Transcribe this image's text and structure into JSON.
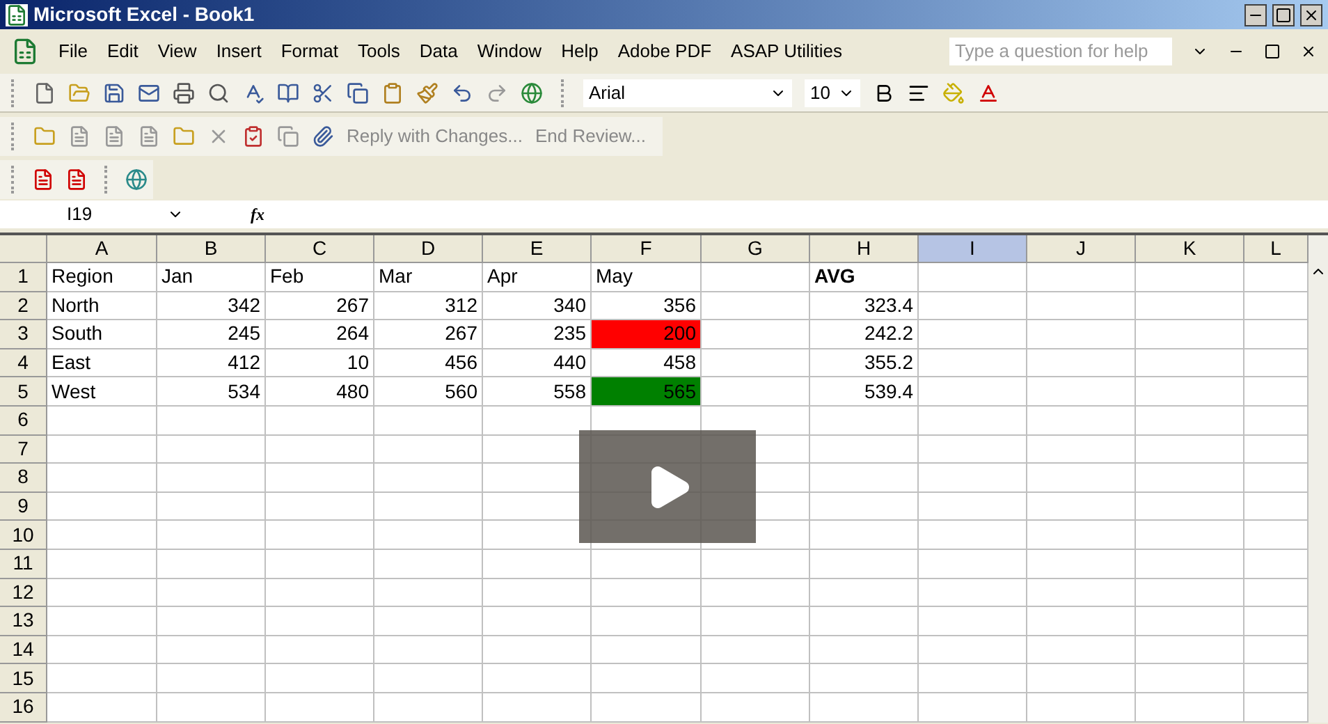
{
  "window": {
    "title": "Microsoft Excel - Book1"
  },
  "menu": [
    "File",
    "Edit",
    "View",
    "Insert",
    "Format",
    "Tools",
    "Data",
    "Window",
    "Help",
    "Adobe PDF",
    "ASAP Utilities"
  ],
  "help_search": {
    "placeholder": "Type a question for help"
  },
  "formatting": {
    "font": "Arial",
    "size": "10"
  },
  "review_toolbar": [
    "Reply with Changes...",
    "End Review..."
  ],
  "name_box": "I19",
  "formula_bar": {
    "label": "fx"
  },
  "columns": [
    {
      "label": "A",
      "selected": false
    },
    {
      "label": "B",
      "selected": false
    },
    {
      "label": "C",
      "selected": false
    },
    {
      "label": "D",
      "selected": false
    },
    {
      "label": "E",
      "selected": false
    },
    {
      "label": "F",
      "selected": false
    },
    {
      "label": "G",
      "selected": false
    },
    {
      "label": "H",
      "selected": false
    },
    {
      "label": "I",
      "selected": true
    },
    {
      "label": "J",
      "selected": false
    },
    {
      "label": "K",
      "selected": false
    },
    {
      "label": "L",
      "selected": false
    }
  ],
  "rows": [
    {
      "number": "1",
      "cells": [
        {
          "text": "Region",
          "kind": "text"
        },
        {
          "text": "Jan",
          "kind": "text"
        },
        {
          "text": "Feb",
          "kind": "text"
        },
        {
          "text": "Mar",
          "kind": "text"
        },
        {
          "text": "Apr",
          "kind": "text"
        },
        {
          "text": "May",
          "kind": "text"
        },
        null,
        {
          "text": "AVG",
          "kind": "heading"
        }
      ]
    },
    {
      "number": "2",
      "cells": [
        {
          "text": "North",
          "kind": "text"
        },
        {
          "text": "342",
          "kind": "number"
        },
        {
          "text": "267",
          "kind": "number"
        },
        {
          "text": "312",
          "kind": "number"
        },
        {
          "text": "340",
          "kind": "number"
        },
        {
          "text": "356",
          "kind": "number"
        },
        null,
        {
          "text": "323.4",
          "kind": "number"
        }
      ]
    },
    {
      "number": "3",
      "cells": [
        {
          "text": "South",
          "kind": "text"
        },
        {
          "text": "245",
          "kind": "number"
        },
        {
          "text": "264",
          "kind": "number"
        },
        {
          "text": "267",
          "kind": "number"
        },
        {
          "text": "235",
          "kind": "number"
        },
        {
          "text": "200",
          "kind": "number",
          "color": "#ff0000"
        },
        null,
        {
          "text": "242.2",
          "kind": "number"
        }
      ]
    },
    {
      "number": "4",
      "cells": [
        {
          "text": "East",
          "kind": "text"
        },
        {
          "text": "412",
          "kind": "number"
        },
        {
          "text": "10",
          "kind": "number"
        },
        {
          "text": "456",
          "kind": "number"
        },
        {
          "text": "440",
          "kind": "number"
        },
        {
          "text": "458",
          "kind": "number"
        },
        null,
        {
          "text": "355.2",
          "kind": "number"
        }
      ]
    },
    {
      "number": "5",
      "cells": [
        {
          "text": "West",
          "kind": "text"
        },
        {
          "text": "534",
          "kind": "number"
        },
        {
          "text": "480",
          "kind": "number"
        },
        {
          "text": "560",
          "kind": "number"
        },
        {
          "text": "558",
          "kind": "number"
        },
        {
          "text": "565",
          "kind": "number",
          "color": "#008000"
        },
        null,
        {
          "text": "539.4",
          "kind": "number"
        }
      ]
    },
    {
      "number": "6",
      "cells": []
    },
    {
      "number": "7",
      "cells": []
    },
    {
      "number": "8",
      "cells": []
    },
    {
      "number": "9",
      "cells": []
    },
    {
      "number": "10",
      "cells": []
    },
    {
      "number": "11",
      "cells": []
    },
    {
      "number": "12",
      "cells": []
    },
    {
      "number": "13",
      "cells": []
    },
    {
      "number": "14",
      "cells": []
    },
    {
      "number": "15",
      "cells": []
    },
    {
      "number": "16",
      "cells": []
    }
  ]
}
